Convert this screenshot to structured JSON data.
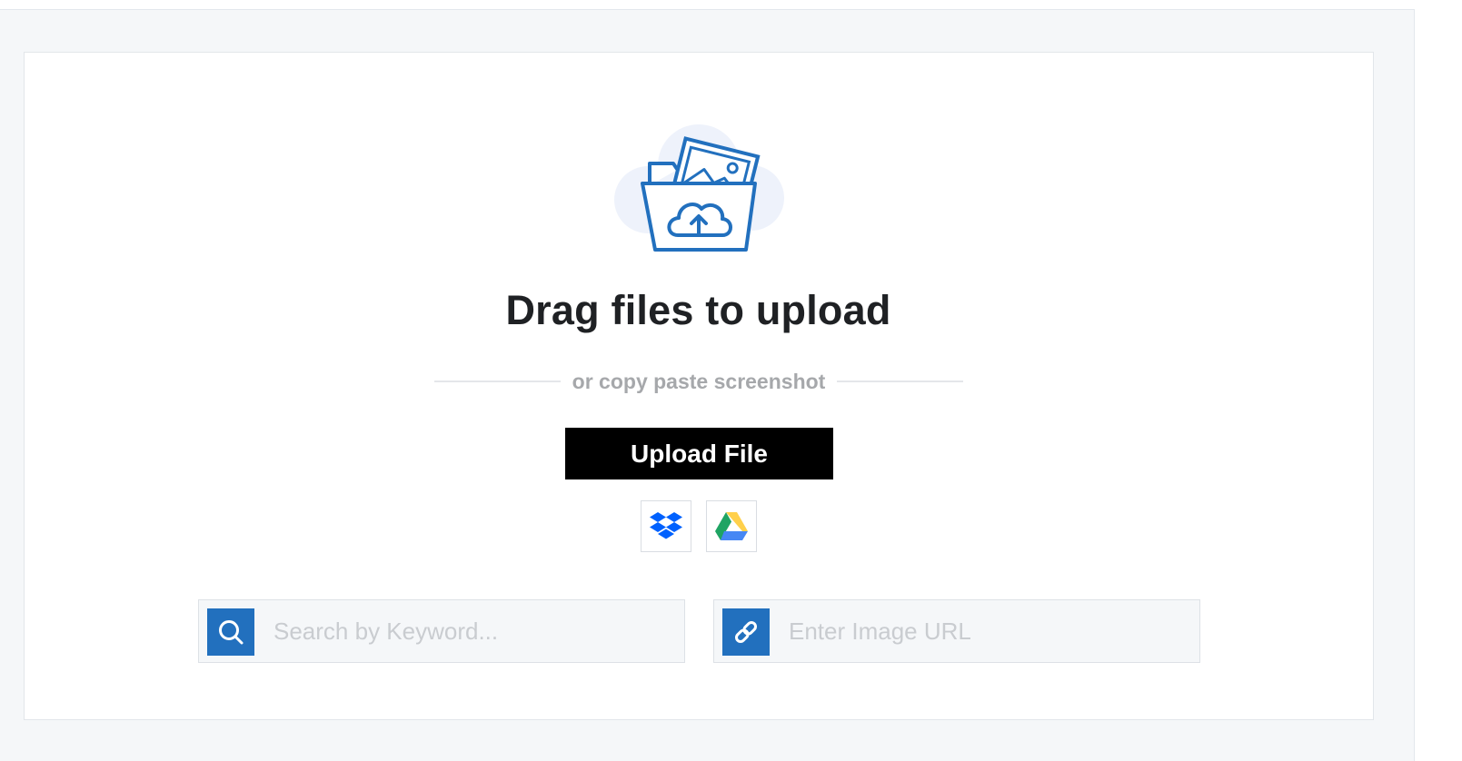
{
  "upload": {
    "title": "Drag files to upload",
    "divider_text": "or copy paste screenshot",
    "upload_button_label": "Upload File",
    "cloud_sources": [
      {
        "name": "dropbox",
        "icon": "dropbox-icon",
        "color": "#0061fe"
      },
      {
        "name": "google-drive",
        "icon": "google-drive-icon",
        "colors": [
          "#1fa463",
          "#ffd04b",
          "#4687f4"
        ]
      }
    ]
  },
  "search": {
    "icon": "search-icon",
    "placeholder": "Search by Keyword...",
    "value": ""
  },
  "url": {
    "icon": "link-icon",
    "placeholder": "Enter Image URL",
    "value": ""
  },
  "colors": {
    "accent": "#2270be",
    "button_bg": "#000000",
    "page_bg": "#f5f7f9",
    "title_text": "#1f2124",
    "muted_text": "#a6a8ab"
  }
}
